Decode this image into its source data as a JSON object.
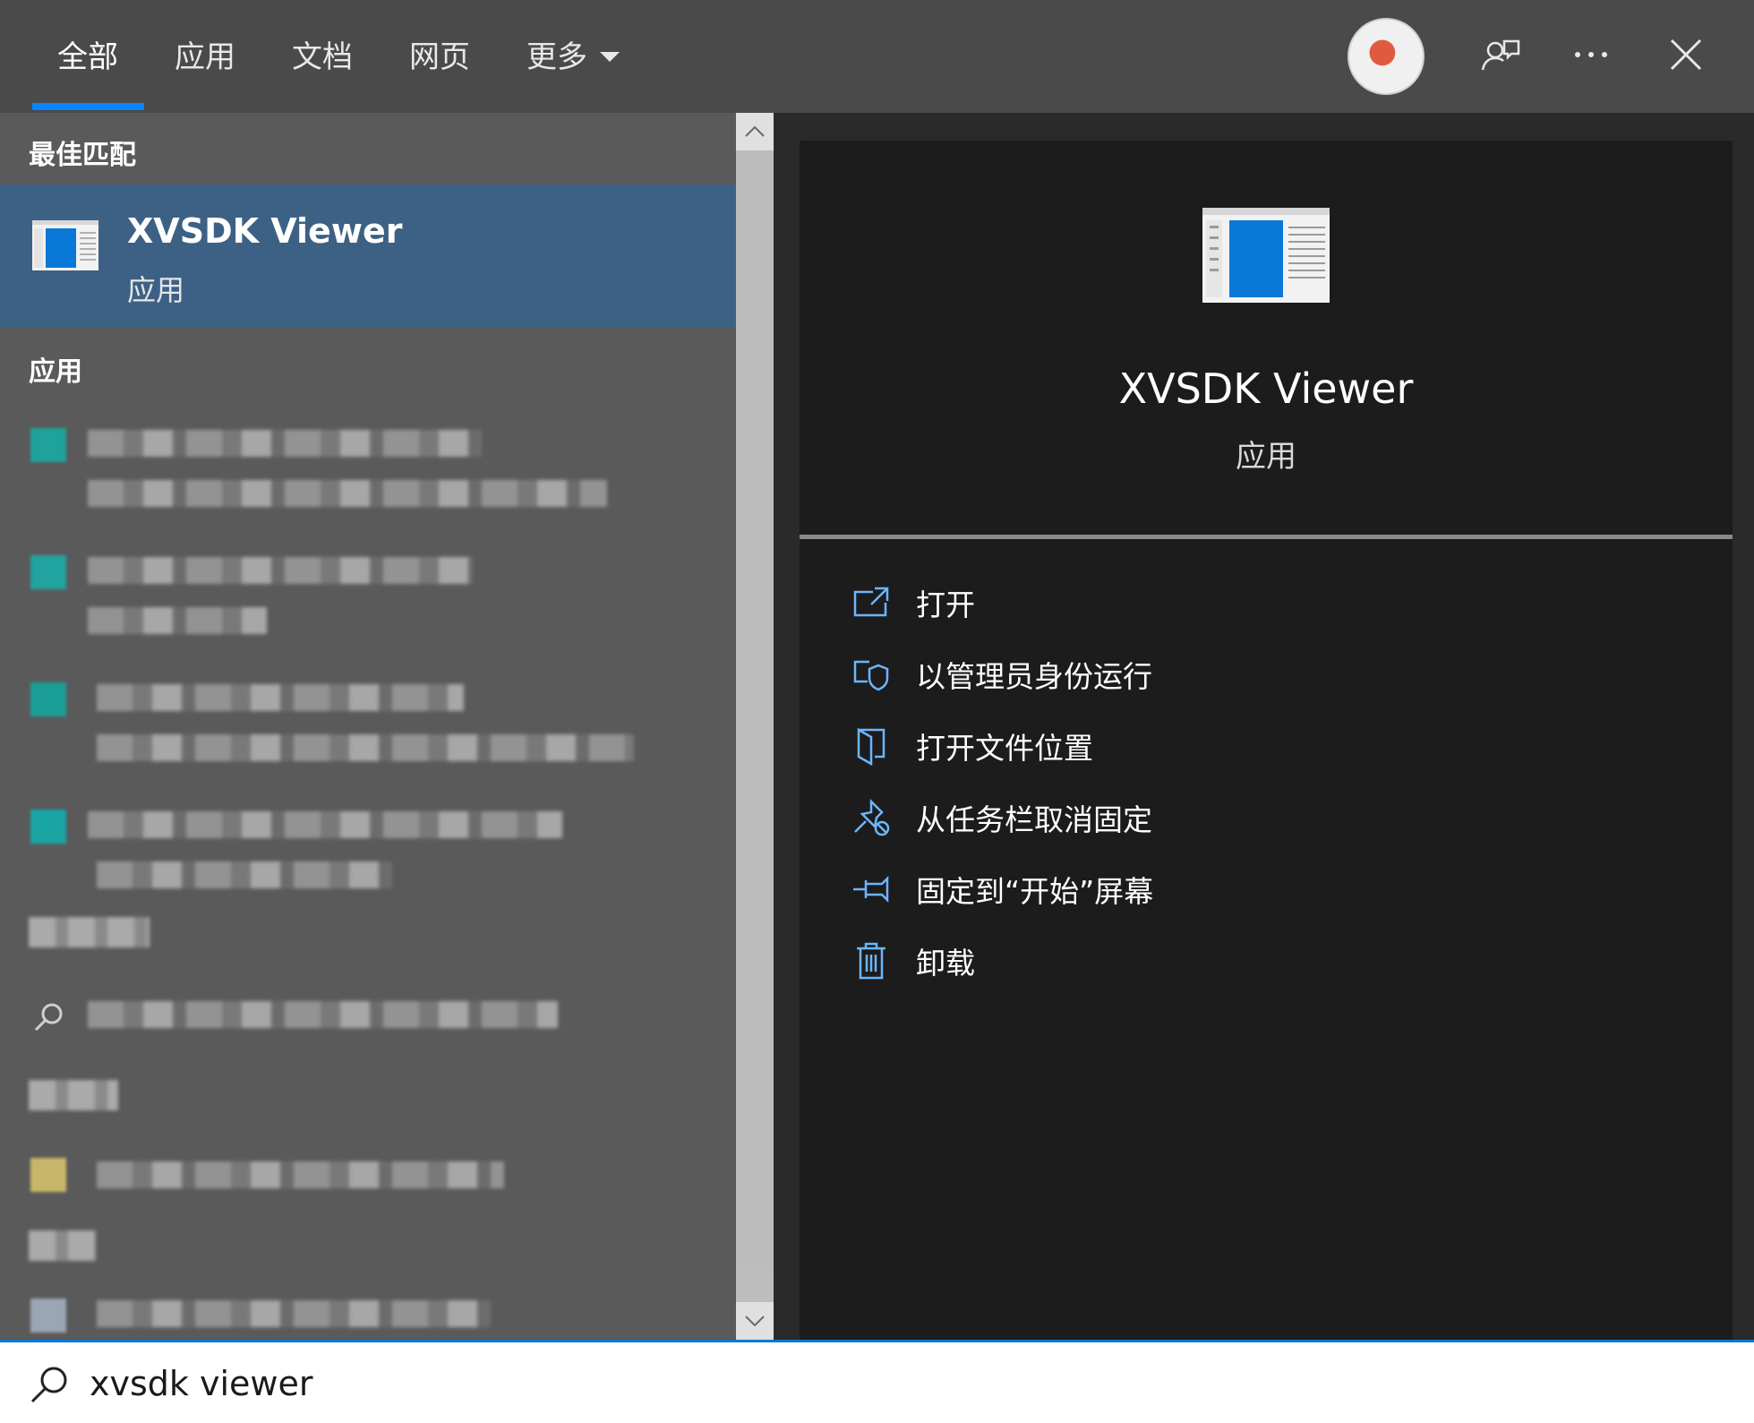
{
  "tabs": [
    {
      "label": "全部"
    },
    {
      "label": "应用"
    },
    {
      "label": "文档"
    },
    {
      "label": "网页"
    },
    {
      "label": "更多"
    }
  ],
  "active_tab_index": 0,
  "sections": {
    "best_match_title": "最佳匹配",
    "apps_title": "应用"
  },
  "best_match": {
    "name": "XVSDK Viewer",
    "type": "应用"
  },
  "detail": {
    "name": "XVSDK Viewer",
    "type": "应用",
    "actions": [
      {
        "label": "打开",
        "icon": "open-icon"
      },
      {
        "label": "以管理员身份运行",
        "icon": "shield-run-icon"
      },
      {
        "label": "打开文件位置",
        "icon": "folder-location-icon"
      },
      {
        "label": "从任务栏取消固定",
        "icon": "unpin-icon"
      },
      {
        "label": "固定到“开始”屏幕",
        "icon": "pin-icon"
      },
      {
        "label": "卸载",
        "icon": "trash-icon"
      }
    ]
  },
  "search": {
    "value": "xvsdk viewer"
  },
  "colors": {
    "accent": "#0a84ff",
    "selected_row": "#3d6185",
    "action_icon": "#6cb6ff"
  }
}
